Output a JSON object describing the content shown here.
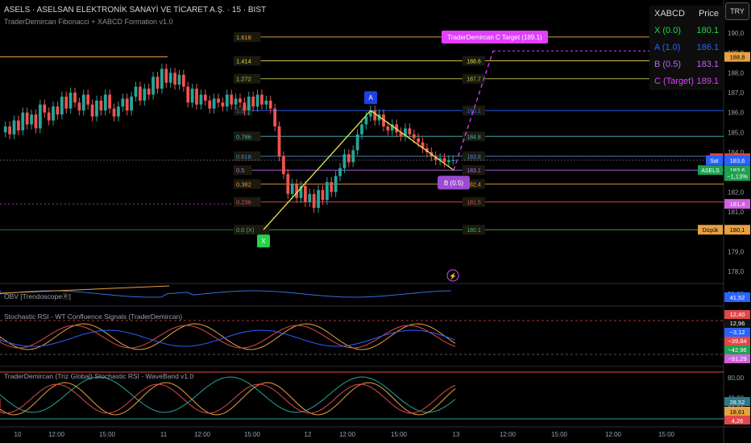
{
  "header": {
    "title": "ASELS · ASELSAN ELEKTRONİK SANAYİ VE TİCARET A.Ş. · 15 · BIST",
    "subtitle": "TraderDemircan Fibonacci + XABCD Formation v1.0",
    "currency_button": "TRY"
  },
  "xabcd_table": {
    "headers": [
      "XABCD",
      "Price"
    ],
    "rows": [
      {
        "label": "X (0.0)",
        "value": "180.1",
        "color": "#22d34a"
      },
      {
        "label": "A (1.0)",
        "value": "186.1",
        "color": "#2962ff"
      },
      {
        "label": "B (0.5)",
        "value": "183.1",
        "color": "#b868e8"
      },
      {
        "label": "C (Target)",
        "value": "189.1",
        "color": "#e040fb"
      }
    ]
  },
  "target_label": "TraderDemircan C Target (189.1)",
  "fib_levels": [
    {
      "ratio": "1.618",
      "price": 189.8,
      "price_label": "",
      "color": "#e0a94a"
    },
    {
      "ratio": "1.414",
      "price": 188.6,
      "price_label": "188.6",
      "color": "#e8d84a"
    },
    {
      "ratio": "1.272",
      "price": 187.7,
      "price_label": "187.7",
      "color": "#c2c24a"
    },
    {
      "ratio": "1.0",
      "price": 186.1,
      "price_label": "186.1",
      "color": "#2962ff"
    },
    {
      "ratio": "0.786",
      "price": 184.8,
      "price_label": "184.8",
      "color": "#4ab8b8"
    },
    {
      "ratio": "0.618",
      "price": 183.8,
      "price_label": "183.8",
      "color": "#4a88c8"
    },
    {
      "ratio": "0.5",
      "price": 183.1,
      "price_label": "183.1",
      "color": "#b868e8"
    },
    {
      "ratio": "0.382",
      "price": 182.4,
      "price_label": "182.4",
      "color": "#e89a3a"
    },
    {
      "ratio": "0.236",
      "price": 181.5,
      "price_label": "181.5",
      "color": "#e05050"
    },
    {
      "ratio": "0.0 (X)",
      "price": 180.1,
      "price_label": "180.1",
      "color": "#4caf50"
    }
  ],
  "points": {
    "X": {
      "label": "X",
      "price": 180.1
    },
    "A": {
      "label": "A",
      "price": 186.1
    },
    "B": {
      "label": "B (0.5)",
      "price": 183.1
    },
    "C": {
      "price": 189.1
    }
  },
  "price_axis": {
    "ticks": [
      "190,0",
      "189,0",
      "188,0",
      "187,0",
      "186,0",
      "185,0",
      "184,0",
      "183,0",
      "182,0",
      "181,0",
      "180,0",
      "179,0",
      "178,0"
    ],
    "badges": [
      {
        "text": "188,8",
        "price": 188.8,
        "bg": "#e8a040",
        "fg": "#000"
      },
      {
        "text": "183,7",
        "price": 183.7,
        "bg": "#e04848",
        "fg": "#fff"
      },
      {
        "text": "183,6",
        "price": 183.6,
        "bg": "#2962ff",
        "fg": "#fff"
      },
      {
        "text": "183,6",
        "price": 183.1,
        "bg": "#1fa050",
        "fg": "#fff"
      },
      {
        "text": "−1,13%",
        "price": 182.8,
        "bg": "#1fa050",
        "fg": "#fff"
      },
      {
        "text": "181,4",
        "price": 181.4,
        "bg": "#d060e0",
        "fg": "#fff"
      },
      {
        "text": "180,1",
        "price": 180.1,
        "bg": "#e8a040",
        "fg": "#000"
      }
    ],
    "side_labels": [
      {
        "text": "Yüksek",
        "price": 188.8
      },
      {
        "text": "Al",
        "price": 183.7
      },
      {
        "text": "Sat",
        "price": 183.6
      },
      {
        "text": "ASELS",
        "price": 183.1
      },
      {
        "text": "Düşük",
        "price": 180.1
      }
    ]
  },
  "indicator_panels": [
    {
      "name": "OBV",
      "label": "OBV [TrendoscopeⓇ]",
      "ticks": [
        "50,00"
      ],
      "badges": [
        {
          "text": "41,52",
          "bg": "#2962ff",
          "fg": "#fff"
        }
      ]
    },
    {
      "name": "StochRSI WT",
      "label": "Stochastic RSI - WT Confluence Signals (TraderDemircan)",
      "ticks": [],
      "badges": [
        {
          "text": "12,40",
          "bg": "#e04848",
          "fg": "#fff"
        },
        {
          "text": "12,96",
          "bg": "#111",
          "fg": "#fff"
        },
        {
          "text": "−3,12",
          "bg": "#2962ff",
          "fg": "#fff"
        },
        {
          "text": "−39,84",
          "bg": "#e04848",
          "fg": "#fff"
        },
        {
          "text": "−42,96",
          "bg": "#1fa050",
          "fg": "#fff"
        },
        {
          "text": "−91,29",
          "bg": "#d060e0",
          "fg": "#fff"
        }
      ]
    },
    {
      "name": "Stoch Wave",
      "label": "TraderDemircan (Triz Global) Stochastic RSI - WaveBand v1.0",
      "ticks": [
        "80,00",
        "40,00",
        "20,00",
        "0,00"
      ],
      "badges": [
        {
          "text": "28,52",
          "bg": "#2a7a8a",
          "fg": "#fff"
        },
        {
          "text": "18,61",
          "bg": "#e8a040",
          "fg": "#000"
        },
        {
          "text": "4,26",
          "bg": "#e04848",
          "fg": "#fff"
        }
      ]
    }
  ],
  "time_axis": [
    "10",
    "12:00",
    "15:00",
    "11",
    "12:00",
    "15:00",
    "12",
    "12:00",
    "15:00",
    "13",
    "12:00",
    "15:00",
    "12:00",
    "15:00"
  ],
  "colors": {
    "up": "#26a69a",
    "down": "#ef5350",
    "xa_line": "#e8e84a",
    "target": "#e040fb"
  }
}
